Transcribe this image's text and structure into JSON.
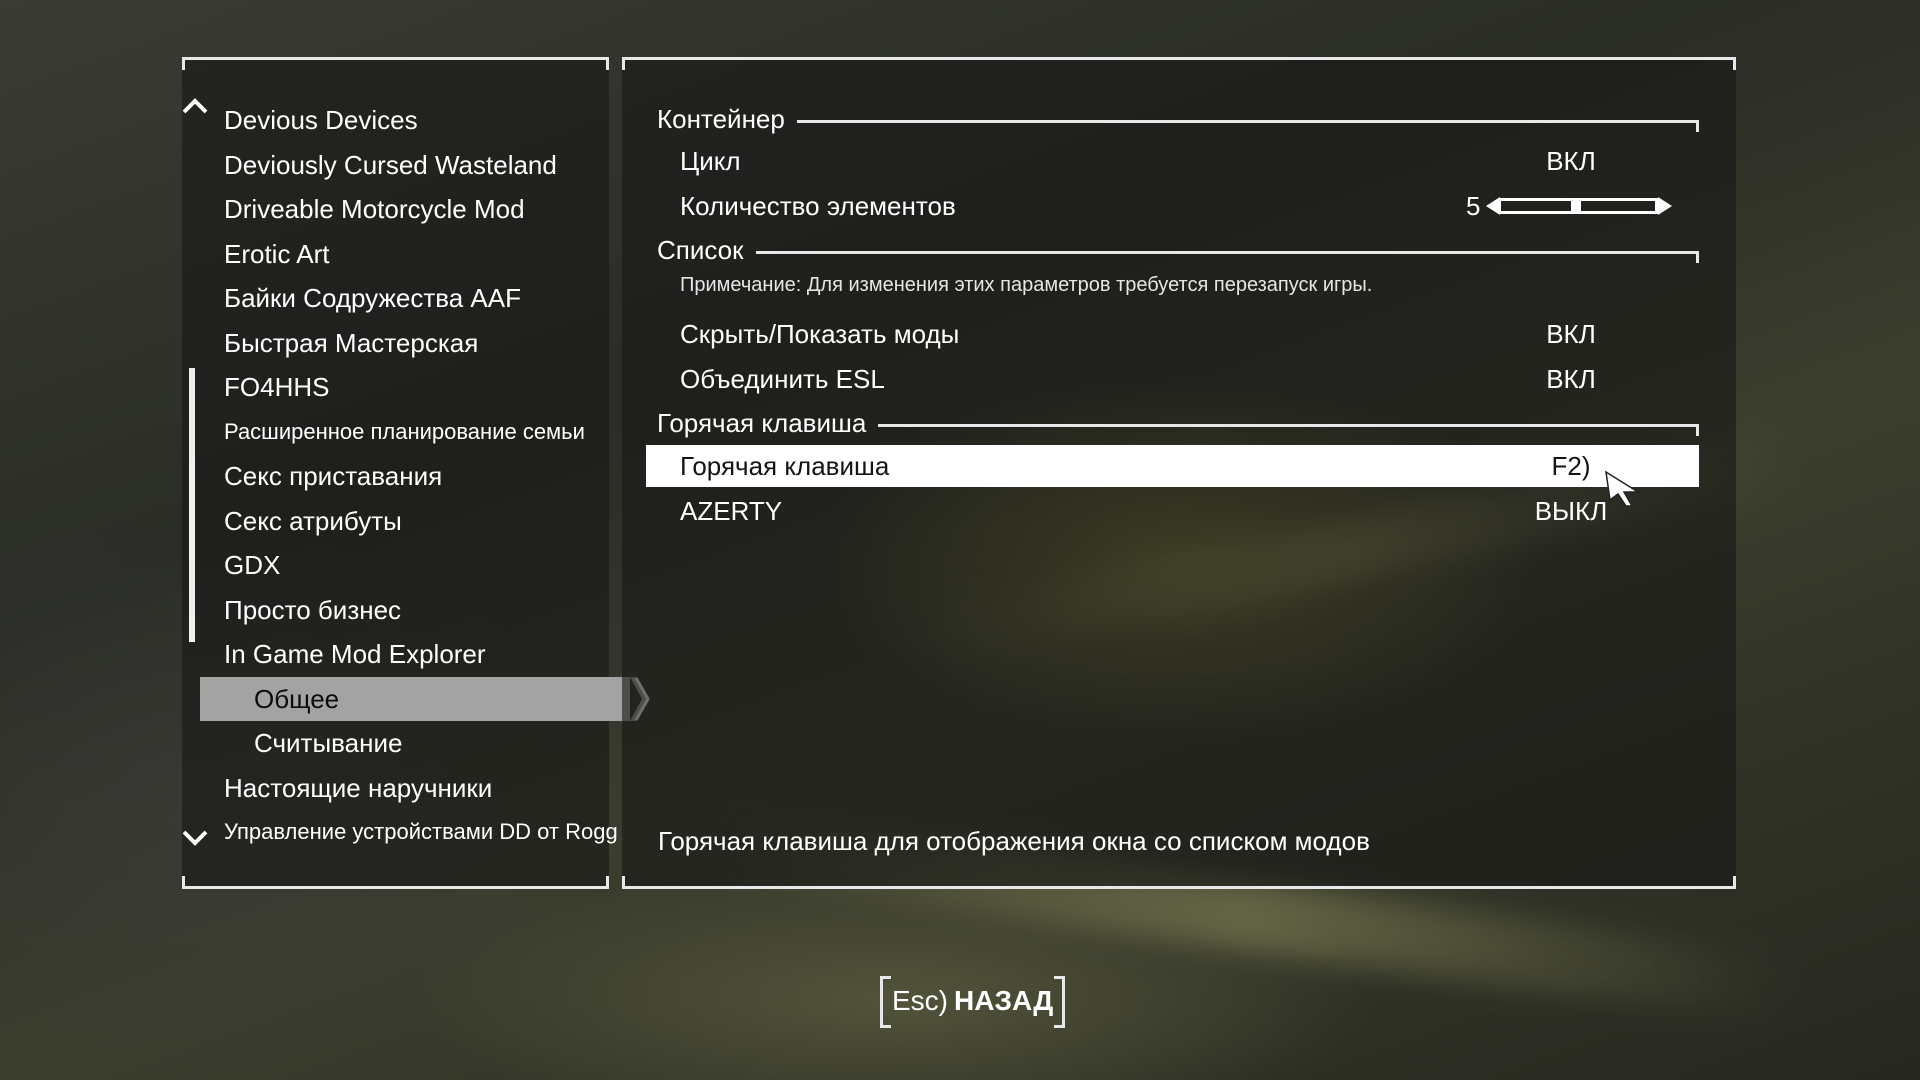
{
  "sidebar": {
    "items": [
      {
        "label": "Devious Devices"
      },
      {
        "label": "Deviously Cursed Wasteland"
      },
      {
        "label": "Driveable Motorcycle Mod"
      },
      {
        "label": "Erotic Art"
      },
      {
        "label": "Байки Содружества AAF"
      },
      {
        "label": "Быстрая Мастерская"
      },
      {
        "label": "FO4HHS"
      },
      {
        "label": "Расширенное планирование семьи"
      },
      {
        "label": "Секс приставания"
      },
      {
        "label": "Секс атрибуты"
      },
      {
        "label": "GDX"
      },
      {
        "label": "Просто бизнес"
      },
      {
        "label": "In Game Mod Explorer"
      },
      {
        "label": "Общее"
      },
      {
        "label": "Считывание"
      },
      {
        "label": "Настоящие наручники"
      },
      {
        "label": "Управление устройствами DD от Rogg"
      }
    ]
  },
  "settings": {
    "section_container": "Контейнер",
    "cycle_label": "Цикл",
    "cycle_value": "ВКЛ",
    "count_label": "Количество элементов",
    "count_value": "5",
    "section_list": "Список",
    "note": "Примечание: Для изменения этих параметров требуется перезапуск игры.",
    "hide_show_label": "Скрыть/Показать моды",
    "hide_show_value": "ВКЛ",
    "merge_esl_label": "Объединить ESL",
    "merge_esl_value": "ВКЛ",
    "section_hotkey": "Горячая клавиша",
    "hotkey_label": "Горячая клавиша",
    "hotkey_value": "F2)",
    "azerty_label": "AZERTY",
    "azerty_value": "ВЫКЛ"
  },
  "description": "Горячая клавиша для отображения окна со списком модов",
  "footer": {
    "back_key": "Esc)",
    "back_label": "НАЗАД"
  }
}
